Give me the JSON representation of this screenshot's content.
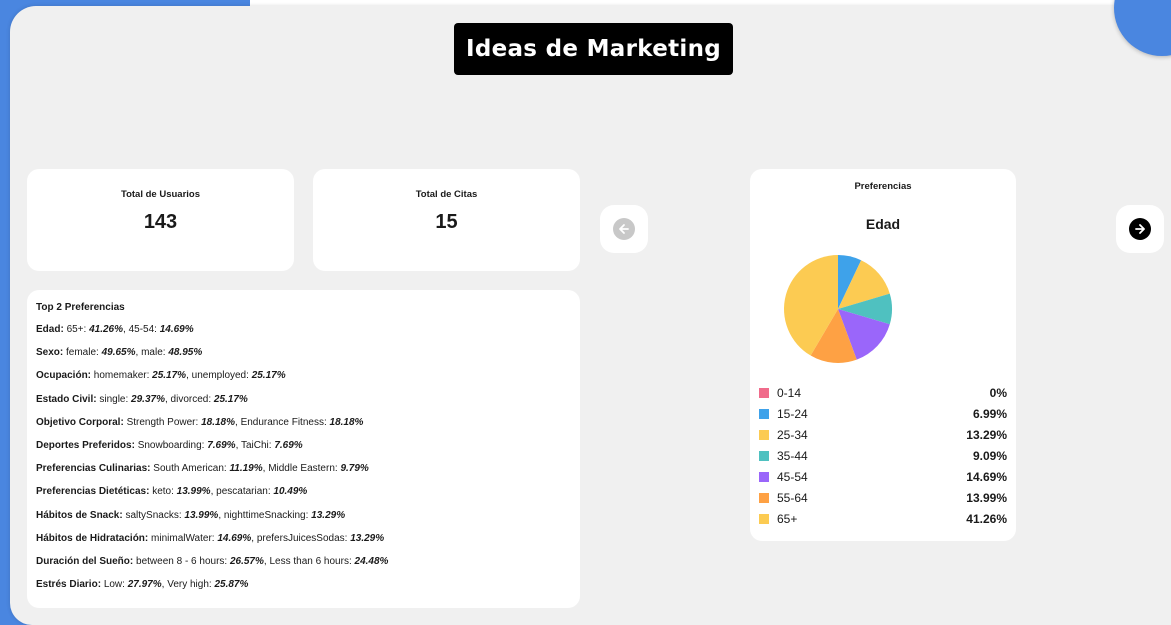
{
  "header": {
    "title": "Ideas de Marketing"
  },
  "stats": [
    {
      "label": "Total de Usuarios",
      "value": "143"
    },
    {
      "label": "Total de Citas",
      "value": "15"
    }
  ],
  "top_prefs": {
    "title": "Top 2 Preferencias",
    "items": [
      {
        "label": "Edad:",
        "a_name": "65+:",
        "a_pct": "41.26%",
        "b_name": "45-54:",
        "b_pct": "14.69%"
      },
      {
        "label": "Sexo:",
        "a_name": "female:",
        "a_pct": "49.65%",
        "b_name": "male:",
        "b_pct": "48.95%"
      },
      {
        "label": "Ocupación:",
        "a_name": "homemaker:",
        "a_pct": "25.17%",
        "b_name": "unemployed:",
        "b_pct": "25.17%"
      },
      {
        "label": "Estado Civil:",
        "a_name": "single:",
        "a_pct": "29.37%",
        "b_name": "divorced:",
        "b_pct": "25.17%"
      },
      {
        "label": "Objetivo Corporal:",
        "a_name": "Strength Power:",
        "a_pct": "18.18%",
        "b_name": "Endurance Fitness:",
        "b_pct": "18.18%"
      },
      {
        "label": "Deportes Preferidos:",
        "a_name": "Snowboarding:",
        "a_pct": "7.69%",
        "b_name": "TaiChi:",
        "b_pct": "7.69%"
      },
      {
        "label": "Preferencias Culinarias:",
        "a_name": "South American:",
        "a_pct": "11.19%",
        "b_name": "Middle Eastern:",
        "b_pct": "9.79%"
      },
      {
        "label": "Preferencias Dietéticas:",
        "a_name": "keto:",
        "a_pct": "13.99%",
        "b_name": "pescatarian:",
        "b_pct": "10.49%"
      },
      {
        "label": "Hábitos de Snack:",
        "a_name": "saltySnacks:",
        "a_pct": "13.99%",
        "b_name": "nighttimeSnacking:",
        "b_pct": "13.29%"
      },
      {
        "label": "Hábitos de Hidratación:",
        "a_name": "minimalWater:",
        "a_pct": "14.69%",
        "b_name": "prefersJuicesSodas:",
        "b_pct": "13.29%"
      },
      {
        "label": "Duración del Sueño:",
        "a_name": "between 8 - 6 hours:",
        "a_pct": "26.57%",
        "b_name": "Less than 6 hours:",
        "b_pct": "24.48%"
      },
      {
        "label": "Estrés Diario:",
        "a_name": "Low:",
        "a_pct": "27.97%",
        "b_name": "Very high:",
        "b_pct": "25.87%"
      }
    ]
  },
  "pie_card": {
    "title": "Preferencias"
  },
  "nav": {
    "prev_icon": "arrow-left-circle-icon",
    "next_icon": "arrow-right-circle-icon",
    "prev_state": "disabled"
  },
  "colors": {
    "accent_blue": "#4a86e0",
    "panel_bg": "#f0f0f0"
  },
  "chart_data": {
    "type": "pie",
    "title": "Edad",
    "categories": [
      "0-14",
      "15-24",
      "25-34",
      "35-44",
      "45-54",
      "55-64",
      "65+"
    ],
    "value_labels": [
      "0%",
      "6.99%",
      "13.29%",
      "9.09%",
      "14.69%",
      "13.99%",
      "41.26%"
    ],
    "values": [
      0,
      6.99,
      13.29,
      9.09,
      14.69,
      13.99,
      41.26
    ],
    "colors": [
      "#f06b8b",
      "#3ea2ea",
      "#fccb52",
      "#4fc1c0",
      "#9a66fa",
      "#fea144",
      "#fccb52"
    ],
    "legend": "bottom"
  }
}
